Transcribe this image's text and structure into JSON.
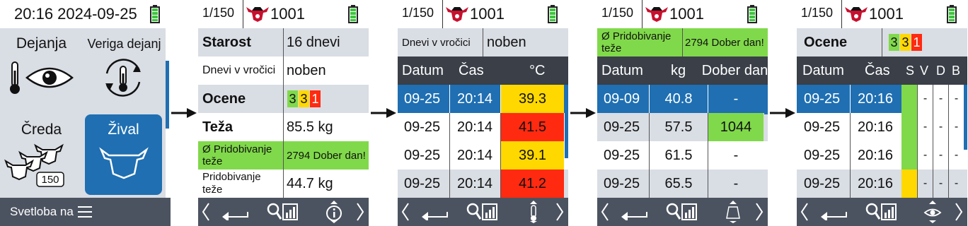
{
  "home": {
    "time": "20:16 2024-09-25",
    "tiles": [
      {
        "label": "Dejanja",
        "icon": "thermometer-eye-icon"
      },
      {
        "label": "Veriga dejanj",
        "icon": "cycle-thermometer-icon"
      },
      {
        "label": "Čreda",
        "icon": "herd-icon",
        "badge": "150"
      },
      {
        "label": "Žival",
        "icon": "cow-head-icon",
        "selected": true
      }
    ],
    "bottom_label": "Svetloba na"
  },
  "header": {
    "counter": "1/150",
    "animal_id": "1001"
  },
  "detail": {
    "rows": [
      {
        "label": "Starost",
        "value": "16 dnevi"
      },
      {
        "label": "Dnevi v vročici",
        "value": "noben"
      },
      {
        "label": "Ocene",
        "scores": [
          "3",
          "3",
          "1"
        ]
      },
      {
        "label": "Teža",
        "value": "85.5 kg"
      },
      {
        "label": "Ø Pridobivanje teže",
        "value": "2794 Dober dan!"
      },
      {
        "label": "Pridobivanje teže",
        "value": "44.7 kg"
      }
    ]
  },
  "temperature": {
    "top_label": "Dnevi v vročici",
    "top_value": "noben",
    "headers": [
      "Datum",
      "Čas",
      "°C"
    ],
    "rows": [
      [
        "09-25",
        "20:14",
        "39.3"
      ],
      [
        "09-25",
        "20:14",
        "41.5"
      ],
      [
        "09-25",
        "20:14",
        "39.1"
      ],
      [
        "09-25",
        "20:14",
        "41.2"
      ]
    ]
  },
  "weight": {
    "top_label": "Ø Pridobivanje teže",
    "top_value": "2794 Dober dan!",
    "headers": [
      "Datum",
      "kg",
      "Dober dan"
    ],
    "rows": [
      [
        "09-09",
        "40.8",
        "-"
      ],
      [
        "09-25",
        "57.5",
        "1044"
      ],
      [
        "09-25",
        "61.5",
        "-"
      ],
      [
        "09-25",
        "65.5",
        "-"
      ]
    ]
  },
  "scores": {
    "top_label": "Ocene",
    "top_scores": [
      "3",
      "3",
      "1"
    ],
    "headers": [
      "Datum",
      "Čas",
      "S",
      "V",
      "D",
      "B"
    ],
    "rows": [
      [
        "09-25",
        "20:16",
        "-",
        "-",
        "-"
      ],
      [
        "09-25",
        "20:16",
        "-",
        "-",
        "-"
      ],
      [
        "09-25",
        "20:16",
        "-",
        "-",
        "-"
      ],
      [
        "09-25",
        "20:16",
        "-",
        "-",
        "-"
      ]
    ]
  },
  "colors": {
    "green": "#80d94a",
    "yellow": "#ffd800",
    "red": "#ff2a10",
    "blue": "#1f6fb2",
    "dark": "#3a3f48"
  }
}
